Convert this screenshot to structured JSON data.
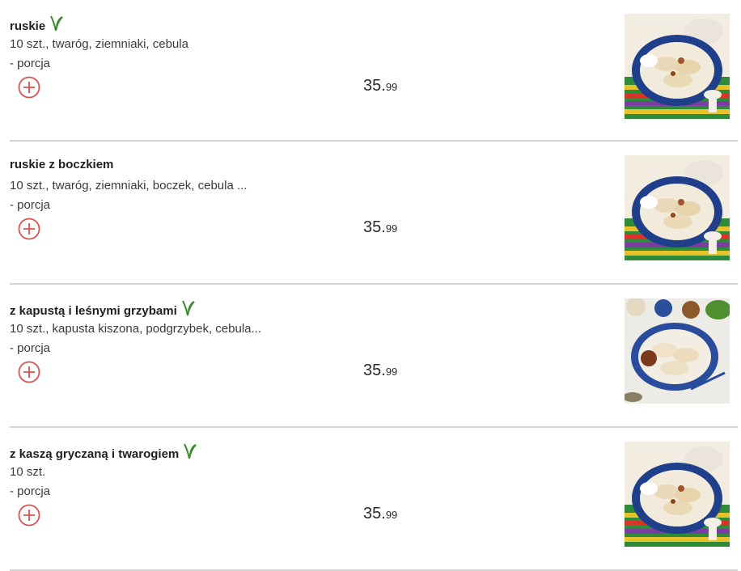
{
  "menu": {
    "items": [
      {
        "name": "ruskie",
        "vegetarian": true,
        "description": "10 szt., twaróg, ziemniaki, cebula",
        "portion": "- porcja",
        "price_main": "35.",
        "price_cents": "99",
        "image": "pierogi-plate"
      },
      {
        "name": "ruskie z boczkiem",
        "vegetarian": false,
        "description": "10 szt., twaróg, ziemniaki, boczek, cebula ...",
        "portion": "- porcja",
        "price_main": "35.",
        "price_cents": "99",
        "image": "pierogi-plate"
      },
      {
        "name": "z kapustą i leśnymi grzybami",
        "vegetarian": true,
        "description": "10 szt., kapusta kiszona, podgrzybek, cebula...",
        "portion": "- porcja",
        "price_main": "35.",
        "price_cents": "99",
        "image": "pierogi-plate-light"
      },
      {
        "name": "z kaszą gryczaną i twarogiem",
        "vegetarian": true,
        "description": "10 szt.",
        "portion": "- porcja",
        "price_main": "35.",
        "price_cents": "99",
        "image": "pierogi-plate"
      }
    ]
  },
  "icons": {
    "add": "plus-circle-icon",
    "vegetarian": "leaf-icon"
  },
  "colors": {
    "add_icon": "#d9534f",
    "leaf": "#3c8a2e",
    "divider": "#d4d4d4"
  }
}
